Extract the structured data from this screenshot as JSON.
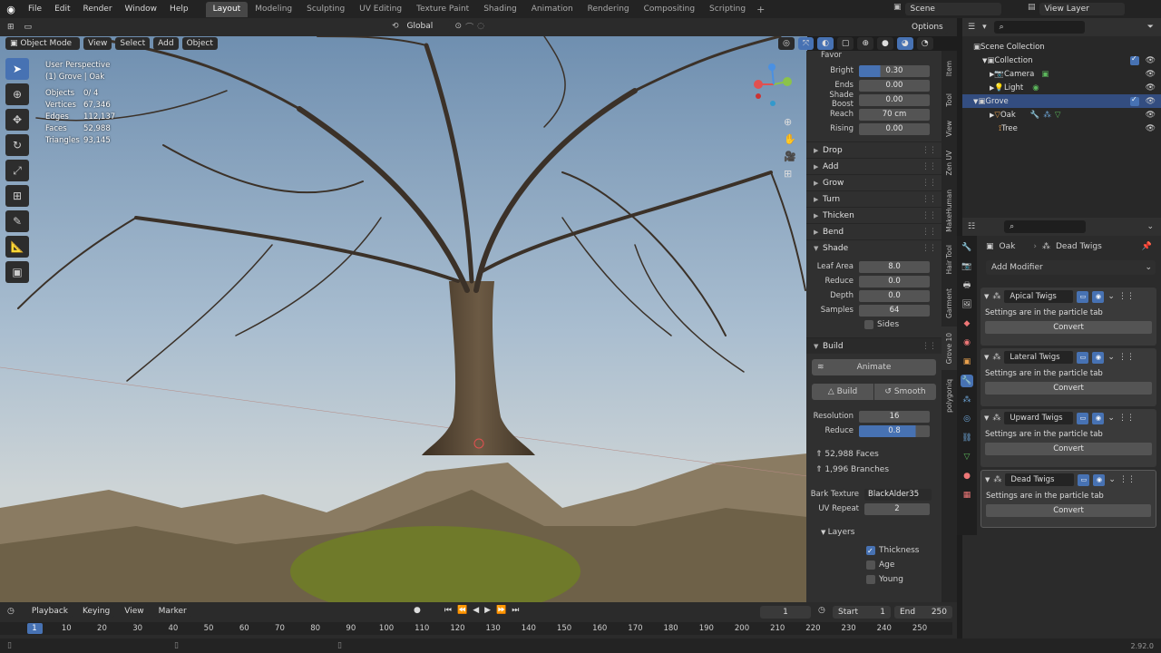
{
  "topbar": {
    "menus": [
      "File",
      "Edit",
      "Render",
      "Window",
      "Help"
    ],
    "workspaces": [
      "Layout",
      "Modeling",
      "Sculpting",
      "UV Editing",
      "Texture Paint",
      "Shading",
      "Animation",
      "Rendering",
      "Compositing",
      "Scripting"
    ],
    "active_workspace": "Layout",
    "scene": "Scene",
    "view_layer": "View Layer"
  },
  "viewport_header": {
    "orientation": "Global",
    "options": "Options",
    "mode": "Object Mode",
    "menus": [
      "View",
      "Select",
      "Add",
      "Object"
    ]
  },
  "viewport": {
    "perspective": "User Perspective",
    "context": "(1) Grove | Oak",
    "stats": [
      {
        "k": "Objects",
        "v": "0/ 4"
      },
      {
        "k": "Vertices",
        "v": "67,346"
      },
      {
        "k": "Edges",
        "v": "112,137"
      },
      {
        "k": "Faces",
        "v": "52,988"
      },
      {
        "k": "Triangles",
        "v": "93,145"
      }
    ]
  },
  "npanel": {
    "top_label": "Favor",
    "favor_rows": [
      {
        "label": "Bright",
        "value": "0.30",
        "fill": 0.3
      },
      {
        "label": "Ends",
        "value": "0.00"
      },
      {
        "label": "Shade Boost",
        "value": "0.00"
      },
      {
        "label": "Reach",
        "value": "70 cm"
      },
      {
        "label": "Rising",
        "value": "0.00"
      }
    ],
    "sections": [
      "Drop",
      "Add",
      "Grow",
      "Turn",
      "Thicken",
      "Bend",
      "Shade"
    ],
    "shade_rows": [
      {
        "label": "Leaf Area",
        "value": "8.0"
      },
      {
        "label": "Reduce",
        "value": "0.0"
      },
      {
        "label": "Depth",
        "value": "0.0"
      },
      {
        "label": "Samples",
        "value": "64"
      }
    ],
    "sides": "Sides",
    "build": {
      "title": "Build",
      "animate": "Animate",
      "build_btn": "Build",
      "smooth_btn": "Smooth",
      "resolution_label": "Resolution",
      "resolution": "16",
      "reduce_label": "Reduce",
      "reduce": "0.8",
      "reduce_fill": 0.8,
      "faces": "52,988 Faces",
      "branches": "1,996 Branches",
      "bark_label": "Bark Texture",
      "bark_value": "BlackAlder35",
      "uv_label": "UV Repeat",
      "uv_value": "2"
    },
    "layers": {
      "title": "Layers",
      "items": [
        {
          "label": "Thickness",
          "checked": true
        },
        {
          "label": "Age",
          "checked": false
        },
        {
          "label": "Young",
          "checked": false
        }
      ]
    }
  },
  "vtabs": [
    "Item",
    "Tool",
    "View",
    "Zen UV",
    "MakeHuman",
    "Hair Tool",
    "Garment",
    "Grove 10",
    "polygoniq"
  ],
  "outliner": {
    "root": "Scene Collection",
    "collection": "Collection",
    "camera": "Camera",
    "light": "Light",
    "grove": "Grove",
    "oak": "Oak",
    "tree": "Tree"
  },
  "properties": {
    "object": "Oak",
    "modifier": "Dead Twigs",
    "add_modifier": "Add Modifier",
    "modifiers": [
      {
        "name": "Apical Twigs",
        "text": "Settings are in the particle tab",
        "btn": "Convert"
      },
      {
        "name": "Lateral Twigs",
        "text": "Settings are in the particle tab",
        "btn": "Convert"
      },
      {
        "name": "Upward Twigs",
        "text": "Settings are in the particle tab",
        "btn": "Convert"
      },
      {
        "name": "Dead Twigs",
        "text": "Settings are in the particle tab",
        "btn": "Convert"
      }
    ]
  },
  "timeline": {
    "menus": [
      "Playback",
      "Keying",
      "View",
      "Marker"
    ],
    "current_frame": "1",
    "start_label": "Start",
    "start": "1",
    "end_label": "End",
    "end": "250",
    "ticks": [
      "1",
      "10",
      "20",
      "30",
      "40",
      "50",
      "60",
      "70",
      "80",
      "90",
      "100",
      "110",
      "120",
      "130",
      "140",
      "150",
      "160",
      "170",
      "180",
      "190",
      "200",
      "210",
      "220",
      "230",
      "240",
      "250"
    ]
  },
  "status": {
    "version": "2.92.0"
  }
}
